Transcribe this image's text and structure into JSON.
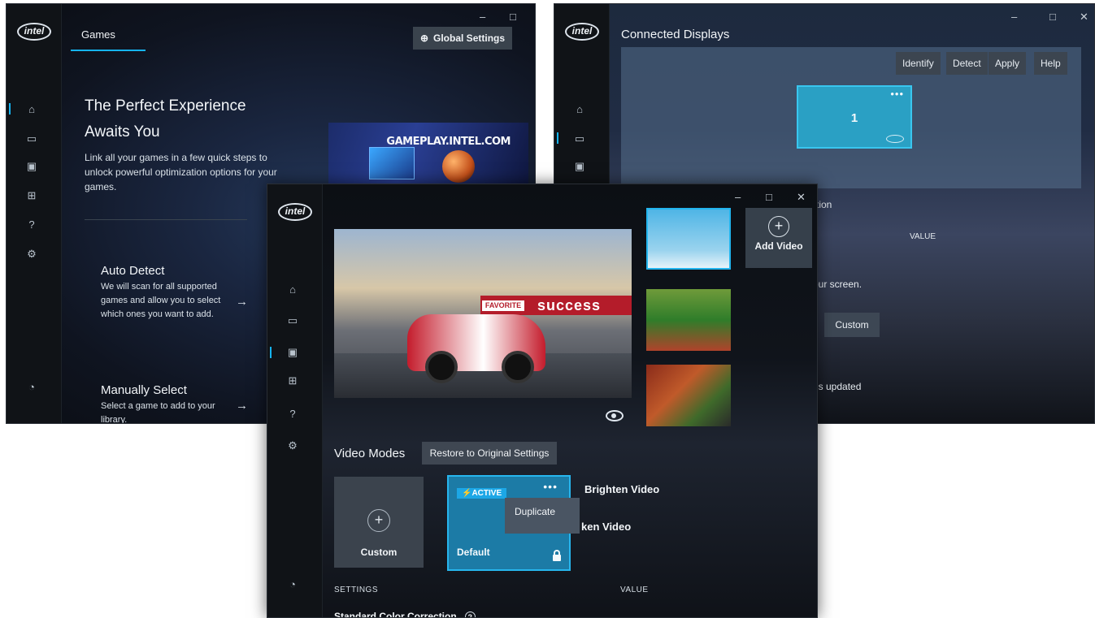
{
  "games_window": {
    "tab_games": "Games",
    "global_settings": "Global Settings",
    "hero_title": "The Perfect Experience Awaits You",
    "hero_subtitle": "Link all your games in a few quick steps to unlock powerful optimization options for your games.",
    "promo_text": "GAMEPLAY.INTEL.COM",
    "auto_detect_title": "Auto Detect",
    "auto_detect_desc": "We will scan for all supported games and allow you to select which ones you want to add.",
    "manual_title": "Manually Select",
    "manual_desc": "Select a game to add to your library."
  },
  "display_window": {
    "title": "Connected Displays",
    "buttons": [
      "Identify",
      "Detect",
      "Apply",
      "Help"
    ],
    "display_number": "1",
    "partial_tion": "tion",
    "value_header": "VALUE",
    "partial_screen": "our screen.",
    "custom_button": "Custom",
    "partial_updated": "is updated"
  },
  "video_window": {
    "preview_banner": "success",
    "preview_favorite": "FAVORITE",
    "add_video": "Add Video",
    "modes_title": "Video Modes",
    "restore_button": "Restore to Original Settings",
    "mode_custom": "Custom",
    "mode_default": "Default",
    "active_badge": "ACTIVE",
    "menu_duplicate": "Duplicate",
    "brighten": "Brighten Video",
    "darken_partial": "ken Video",
    "settings_header": "SETTINGS",
    "value_header": "VALUE",
    "standard_color": "Standard Color Correction"
  },
  "logo_text": "intel",
  "colors": {
    "accent": "#15b4f1",
    "tile": "#1c7ba6"
  }
}
